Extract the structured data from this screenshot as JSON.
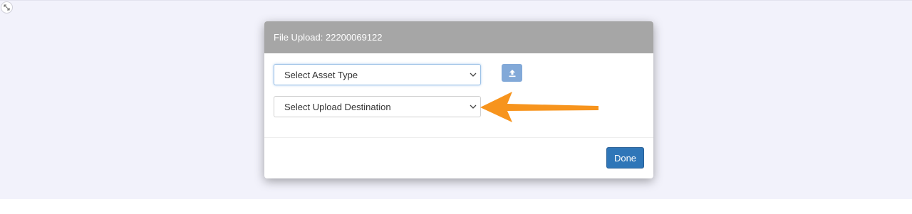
{
  "modal": {
    "title": "File Upload: 22200069122",
    "asset_type_select": {
      "selected": "Select Asset Type"
    },
    "upload_destination_select": {
      "selected": "Select Upload Destination"
    },
    "done_label": "Done"
  },
  "icons": {
    "expand": "expand-arrows-icon",
    "upload": "upload-icon",
    "select_caret": "chevron-down-icon",
    "annotation": "orange-arrow-annotation"
  },
  "colors": {
    "page_background": "#f2f2fb",
    "modal_header": "#a6a6a6",
    "upload_button": "#82a9d8",
    "done_button": "#2f76b8",
    "annotation_arrow": "#f7941d"
  }
}
